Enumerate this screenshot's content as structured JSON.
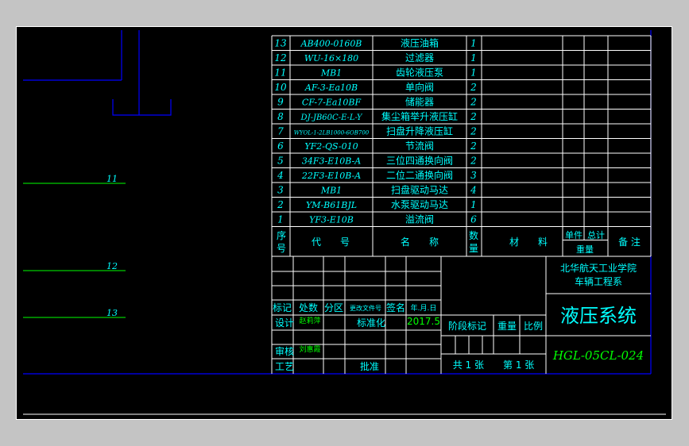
{
  "colors": {
    "background": "#000000",
    "frame": "#c4c4c4",
    "table_lines": "#ffffff",
    "text_cyan": "#00ffff",
    "text_green": "#00ff00",
    "text_yellow": "#ffff00",
    "blue_lines": "#0000ff",
    "leader_lines": "#00ff00"
  },
  "callouts": [
    "11",
    "12",
    "13"
  ],
  "parts": [
    {
      "no": "13",
      "code": "AB400-0160B",
      "name": "液压油箱",
      "qty": "1"
    },
    {
      "no": "12",
      "code": "WU-16×180",
      "name": "过滤器",
      "qty": "1"
    },
    {
      "no": "11",
      "code": "MB1",
      "name": "齿轮液压泵",
      "qty": "1"
    },
    {
      "no": "10",
      "code": "AF-3-Ea10B",
      "name": "单向阀",
      "qty": "2"
    },
    {
      "no": "9",
      "code": "CF-7-Ea10BF",
      "name": "储能器",
      "qty": "2"
    },
    {
      "no": "8",
      "code": "DJ-JB60C-E-L-Y",
      "name": "集尘箱举升液压缸",
      "qty": "2"
    },
    {
      "no": "7",
      "code": "WYOL-1-2LB1000-6OB700",
      "name": "扫盘升降液压缸",
      "qty": "2"
    },
    {
      "no": "6",
      "code": "YF2-QS-010",
      "name": "节流阀",
      "qty": "2"
    },
    {
      "no": "5",
      "code": "34F3-E10B-A",
      "name": "三位四通换向阀",
      "qty": "2"
    },
    {
      "no": "4",
      "code": "22F3-E10B-A",
      "name": "二位二通换向阀",
      "qty": "3"
    },
    {
      "no": "3",
      "code": "MB1",
      "name": "扫盘驱动马达",
      "qty": "4"
    },
    {
      "no": "2",
      "code": "YM-B61BJL",
      "name": "水泵驱动马达",
      "qty": "1"
    },
    {
      "no": "1",
      "code": "YF3-E10B",
      "name": "溢流阀",
      "qty": "6"
    }
  ],
  "header": {
    "no": "序号",
    "code": "代　　号",
    "name": "名　　称",
    "qty": "数量",
    "material": "材　　料",
    "unit": "单件",
    "total": "总计",
    "weight": "重量",
    "remarks": "备 注"
  },
  "title_block": {
    "mark": "标记",
    "count": "处数",
    "zone": "分区",
    "doc_no": "更改文件号",
    "sign": "签名",
    "date": "年.月.日",
    "design": "设计",
    "designer": "赵莉萍",
    "standard": "标准化",
    "year": "2017.5",
    "stage": "阶段标记",
    "weight": "重量",
    "scale": "比例",
    "review": "审核",
    "reviewer": "刘惠霞",
    "process": "工艺",
    "approve": "批准",
    "sheets": "共 1 张　　第 1 张",
    "school": "北华航天工业学院",
    "department": "车辆工程系",
    "drawing_title": "液压系统",
    "drawing_no": "HGL-05CL-024"
  }
}
